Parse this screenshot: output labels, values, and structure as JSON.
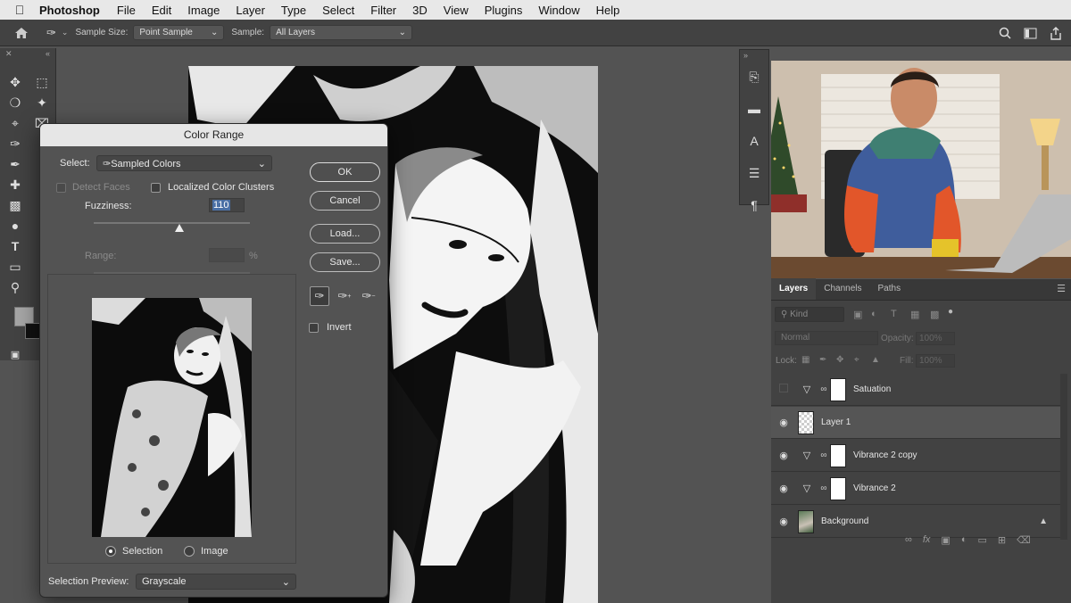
{
  "menubar": {
    "app_name": "Photoshop",
    "items": [
      "File",
      "Edit",
      "Image",
      "Layer",
      "Type",
      "Select",
      "Filter",
      "3D",
      "View",
      "Plugins",
      "Window",
      "Help"
    ]
  },
  "options_bar": {
    "sample_size_label": "Sample Size:",
    "sample_size_value": "Point Sample",
    "sample_label": "Sample:",
    "sample_value": "All Layers"
  },
  "dialog": {
    "title": "Color Range",
    "select_label": "Select:",
    "select_value": "Sampled Colors",
    "detect_faces": "Detect Faces",
    "localized_clusters": "Localized Color Clusters",
    "fuzziness_label": "Fuzziness:",
    "fuzziness_value": "110",
    "range_label": "Range:",
    "range_unit": "%",
    "buttons": {
      "ok": "OK",
      "cancel": "Cancel",
      "load": "Load...",
      "save": "Save..."
    },
    "invert": "Invert",
    "radio_selection": "Selection",
    "radio_image": "Image",
    "preview_label": "Selection Preview:",
    "preview_value": "Grayscale",
    "fuzziness_fraction": 0.55
  },
  "layers_panel": {
    "tabs": [
      "Layers",
      "Channels",
      "Paths"
    ],
    "kind": "Kind",
    "blend_mode": "Normal",
    "opacity_label": "Opacity:",
    "opacity_value": "100%",
    "lock_label": "Lock:",
    "fill_label": "Fill:",
    "fill_value": "100%",
    "layers": [
      {
        "name": "Satuation"
      },
      {
        "name": "Layer 1"
      },
      {
        "name": "Vibrance 2 copy"
      },
      {
        "name": "Vibrance 2"
      },
      {
        "name": "Background"
      }
    ]
  },
  "colors": {
    "accent_field": "#4a6fa5",
    "panel": "#424242",
    "canvas_bg": "#535353"
  }
}
